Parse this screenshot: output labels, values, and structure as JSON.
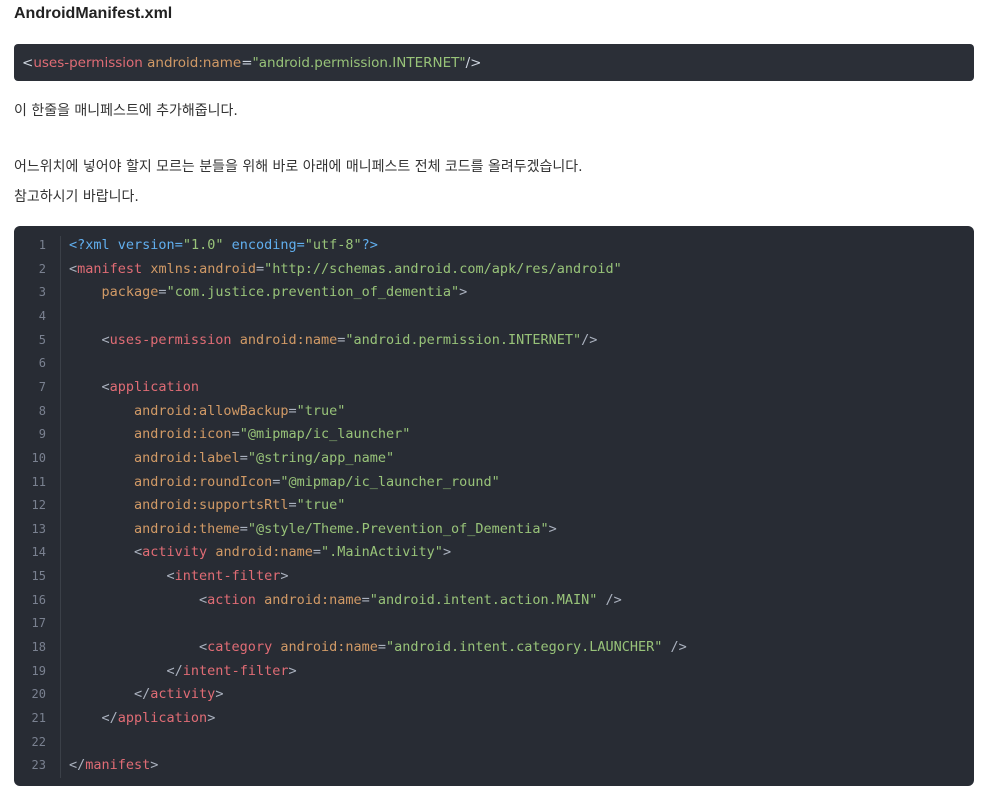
{
  "heading": "AndroidManifest.xml",
  "snippet": {
    "tokens": [
      {
        "t": "<",
        "c": "s-punc"
      },
      {
        "t": "uses-permission",
        "c": "s-tag"
      },
      {
        "t": " ",
        "c": "s-punc"
      },
      {
        "t": "android:name",
        "c": "s-attr"
      },
      {
        "t": "=",
        "c": "s-punc"
      },
      {
        "t": "\"android.permission.INTERNET\"",
        "c": "s-str"
      },
      {
        "t": "/>",
        "c": "s-punc"
      }
    ]
  },
  "paragraphs": {
    "p1": "이 한줄을 매니페스트에 추가해줍니다.",
    "p2": "어느위치에 넣어야 할지 모르는 분들을 위해 바로 아래에 매니페스트 전체 코드를 올려두겠습니다.",
    "p3": "참고하시기 바랍니다."
  },
  "code_lines": [
    {
      "n": "1",
      "tokens": [
        {
          "t": "<?xml ",
          "c": "t-decl"
        },
        {
          "t": "version",
          "c": "t-decl"
        },
        {
          "t": "=",
          "c": "t-decl"
        },
        {
          "t": "\"1.0\"",
          "c": "t-str"
        },
        {
          "t": " encoding",
          "c": "t-decl"
        },
        {
          "t": "=",
          "c": "t-decl"
        },
        {
          "t": "\"utf-8\"",
          "c": "t-str"
        },
        {
          "t": "?>",
          "c": "t-decl"
        }
      ]
    },
    {
      "n": "2",
      "tokens": [
        {
          "t": "<",
          "c": "t-punc"
        },
        {
          "t": "manifest",
          "c": "t-tag"
        },
        {
          "t": " ",
          "c": "t-punc"
        },
        {
          "t": "xmlns:android",
          "c": "t-attr"
        },
        {
          "t": "=",
          "c": "t-punc"
        },
        {
          "t": "\"http://schemas.android.com/apk/res/android\"",
          "c": "t-str"
        }
      ]
    },
    {
      "n": "3",
      "tokens": [
        {
          "t": "    ",
          "c": "t-punc"
        },
        {
          "t": "package",
          "c": "t-attr"
        },
        {
          "t": "=",
          "c": "t-punc"
        },
        {
          "t": "\"com.justice.prevention_of_dementia\"",
          "c": "t-str"
        },
        {
          "t": ">",
          "c": "t-punc"
        }
      ]
    },
    {
      "n": "4",
      "tokens": []
    },
    {
      "n": "5",
      "tokens": [
        {
          "t": "    <",
          "c": "t-punc"
        },
        {
          "t": "uses-permission",
          "c": "t-tag"
        },
        {
          "t": " ",
          "c": "t-punc"
        },
        {
          "t": "android:name",
          "c": "t-attr"
        },
        {
          "t": "=",
          "c": "t-punc"
        },
        {
          "t": "\"android.permission.INTERNET\"",
          "c": "t-str"
        },
        {
          "t": "/>",
          "c": "t-punc"
        }
      ]
    },
    {
      "n": "6",
      "tokens": []
    },
    {
      "n": "7",
      "tokens": [
        {
          "t": "    <",
          "c": "t-punc"
        },
        {
          "t": "application",
          "c": "t-tag"
        }
      ]
    },
    {
      "n": "8",
      "tokens": [
        {
          "t": "        ",
          "c": "t-punc"
        },
        {
          "t": "android:allowBackup",
          "c": "t-attr"
        },
        {
          "t": "=",
          "c": "t-punc"
        },
        {
          "t": "\"true\"",
          "c": "t-str"
        }
      ]
    },
    {
      "n": "9",
      "tokens": [
        {
          "t": "        ",
          "c": "t-punc"
        },
        {
          "t": "android:icon",
          "c": "t-attr"
        },
        {
          "t": "=",
          "c": "t-punc"
        },
        {
          "t": "\"@mipmap/ic_launcher\"",
          "c": "t-str"
        }
      ]
    },
    {
      "n": "10",
      "tokens": [
        {
          "t": "        ",
          "c": "t-punc"
        },
        {
          "t": "android:label",
          "c": "t-attr"
        },
        {
          "t": "=",
          "c": "t-punc"
        },
        {
          "t": "\"@string/app_name\"",
          "c": "t-str"
        }
      ]
    },
    {
      "n": "11",
      "tokens": [
        {
          "t": "        ",
          "c": "t-punc"
        },
        {
          "t": "android:roundIcon",
          "c": "t-attr"
        },
        {
          "t": "=",
          "c": "t-punc"
        },
        {
          "t": "\"@mipmap/ic_launcher_round\"",
          "c": "t-str"
        }
      ]
    },
    {
      "n": "12",
      "tokens": [
        {
          "t": "        ",
          "c": "t-punc"
        },
        {
          "t": "android:supportsRtl",
          "c": "t-attr"
        },
        {
          "t": "=",
          "c": "t-punc"
        },
        {
          "t": "\"true\"",
          "c": "t-str"
        }
      ]
    },
    {
      "n": "13",
      "tokens": [
        {
          "t": "        ",
          "c": "t-punc"
        },
        {
          "t": "android:theme",
          "c": "t-attr"
        },
        {
          "t": "=",
          "c": "t-punc"
        },
        {
          "t": "\"@style/Theme.Prevention_of_Dementia\"",
          "c": "t-str"
        },
        {
          "t": ">",
          "c": "t-punc"
        }
      ]
    },
    {
      "n": "14",
      "tokens": [
        {
          "t": "        <",
          "c": "t-punc"
        },
        {
          "t": "activity",
          "c": "t-tag"
        },
        {
          "t": " ",
          "c": "t-punc"
        },
        {
          "t": "android:name",
          "c": "t-attr"
        },
        {
          "t": "=",
          "c": "t-punc"
        },
        {
          "t": "\".MainActivity\"",
          "c": "t-str"
        },
        {
          "t": ">",
          "c": "t-punc"
        }
      ]
    },
    {
      "n": "15",
      "tokens": [
        {
          "t": "            <",
          "c": "t-punc"
        },
        {
          "t": "intent-filter",
          "c": "t-tag"
        },
        {
          "t": ">",
          "c": "t-punc"
        }
      ]
    },
    {
      "n": "16",
      "tokens": [
        {
          "t": "                <",
          "c": "t-punc"
        },
        {
          "t": "action",
          "c": "t-tag"
        },
        {
          "t": " ",
          "c": "t-punc"
        },
        {
          "t": "android:name",
          "c": "t-attr"
        },
        {
          "t": "=",
          "c": "t-punc"
        },
        {
          "t": "\"android.intent.action.MAIN\"",
          "c": "t-str"
        },
        {
          "t": " />",
          "c": "t-punc"
        }
      ]
    },
    {
      "n": "17",
      "tokens": []
    },
    {
      "n": "18",
      "tokens": [
        {
          "t": "                <",
          "c": "t-punc"
        },
        {
          "t": "category",
          "c": "t-tag"
        },
        {
          "t": " ",
          "c": "t-punc"
        },
        {
          "t": "android:name",
          "c": "t-attr"
        },
        {
          "t": "=",
          "c": "t-punc"
        },
        {
          "t": "\"android.intent.category.LAUNCHER\"",
          "c": "t-str"
        },
        {
          "t": " />",
          "c": "t-punc"
        }
      ]
    },
    {
      "n": "19",
      "tokens": [
        {
          "t": "            </",
          "c": "t-punc"
        },
        {
          "t": "intent-filter",
          "c": "t-tag"
        },
        {
          "t": ">",
          "c": "t-punc"
        }
      ]
    },
    {
      "n": "20",
      "tokens": [
        {
          "t": "        </",
          "c": "t-punc"
        },
        {
          "t": "activity",
          "c": "t-tag"
        },
        {
          "t": ">",
          "c": "t-punc"
        }
      ]
    },
    {
      "n": "21",
      "tokens": [
        {
          "t": "    </",
          "c": "t-punc"
        },
        {
          "t": "application",
          "c": "t-tag"
        },
        {
          "t": ">",
          "c": "t-punc"
        }
      ]
    },
    {
      "n": "22",
      "tokens": []
    },
    {
      "n": "23",
      "tokens": [
        {
          "t": "</",
          "c": "t-punc"
        },
        {
          "t": "manifest",
          "c": "t-tag"
        },
        {
          "t": ">",
          "c": "t-punc"
        }
      ]
    }
  ]
}
